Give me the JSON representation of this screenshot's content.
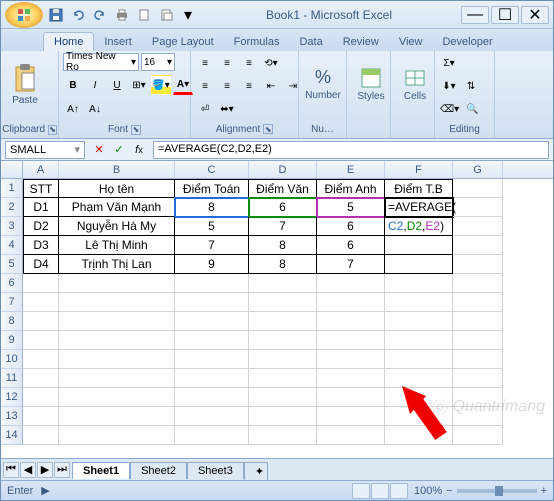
{
  "window": {
    "title": "Book1 - Microsoft Excel",
    "qat_icons": [
      "save-icon",
      "undo-icon",
      "redo-icon",
      "print-icon",
      "new-icon",
      "open-icon",
      "more-icon"
    ]
  },
  "tabs": [
    "Home",
    "Insert",
    "Page Layout",
    "Formulas",
    "Data",
    "Review",
    "View",
    "Developer"
  ],
  "active_tab": 0,
  "ribbon": {
    "clipboard": {
      "label": "Clipboard",
      "paste": "Paste"
    },
    "font": {
      "label": "Font",
      "name": "Times New Ro",
      "size": "16"
    },
    "alignment": {
      "label": "Alignment"
    },
    "number": {
      "label": "Nu…",
      "btn": "Number"
    },
    "styles": {
      "label": "",
      "btn": "Styles"
    },
    "cells": {
      "label": "",
      "btn": "Cells"
    },
    "editing": {
      "label": "Editing"
    }
  },
  "formula_bar": {
    "name_box": "SMALL",
    "formula": "=AVERAGE(C2,D2,E2)"
  },
  "columns": [
    "A",
    "B",
    "C",
    "D",
    "E",
    "F",
    "G"
  ],
  "row_numbers": [
    "1",
    "2",
    "3",
    "4",
    "5",
    "6",
    "7",
    "8",
    "9",
    "10",
    "11",
    "12",
    "13",
    "14"
  ],
  "table": {
    "headers": {
      "a": "STT",
      "b": "Họ tên",
      "c": "Điểm Toán",
      "d": "Điểm Văn",
      "e": "Điểm Anh",
      "f": "Điểm T.B"
    },
    "rows": [
      {
        "a": "D1",
        "b": "Phạm Văn Mạnh",
        "c": "8",
        "d": "6",
        "e": "5",
        "f": "=AVERAGE("
      },
      {
        "a": "D2",
        "b": "Nguyễn Hà My",
        "c": "5",
        "d": "7",
        "e": "6",
        "f": ""
      },
      {
        "a": "D3",
        "b": "Lê Thị Minh",
        "c": "7",
        "d": "8",
        "e": "6",
        "f": ""
      },
      {
        "a": "D4",
        "b": "Trịnh Thị Lan",
        "c": "9",
        "d": "8",
        "e": "7",
        "f": ""
      }
    ],
    "f3_overflow": {
      "c2": "C2",
      "d2": "D2",
      "e2": "E2",
      "comma": ",",
      "paren": ")"
    }
  },
  "sheets": [
    "Sheet1",
    "Sheet2",
    "Sheet3"
  ],
  "active_sheet": 0,
  "status": {
    "mode": "Enter",
    "zoom": "100%",
    "macro": "📷"
  },
  "watermark": "Quantrimang"
}
